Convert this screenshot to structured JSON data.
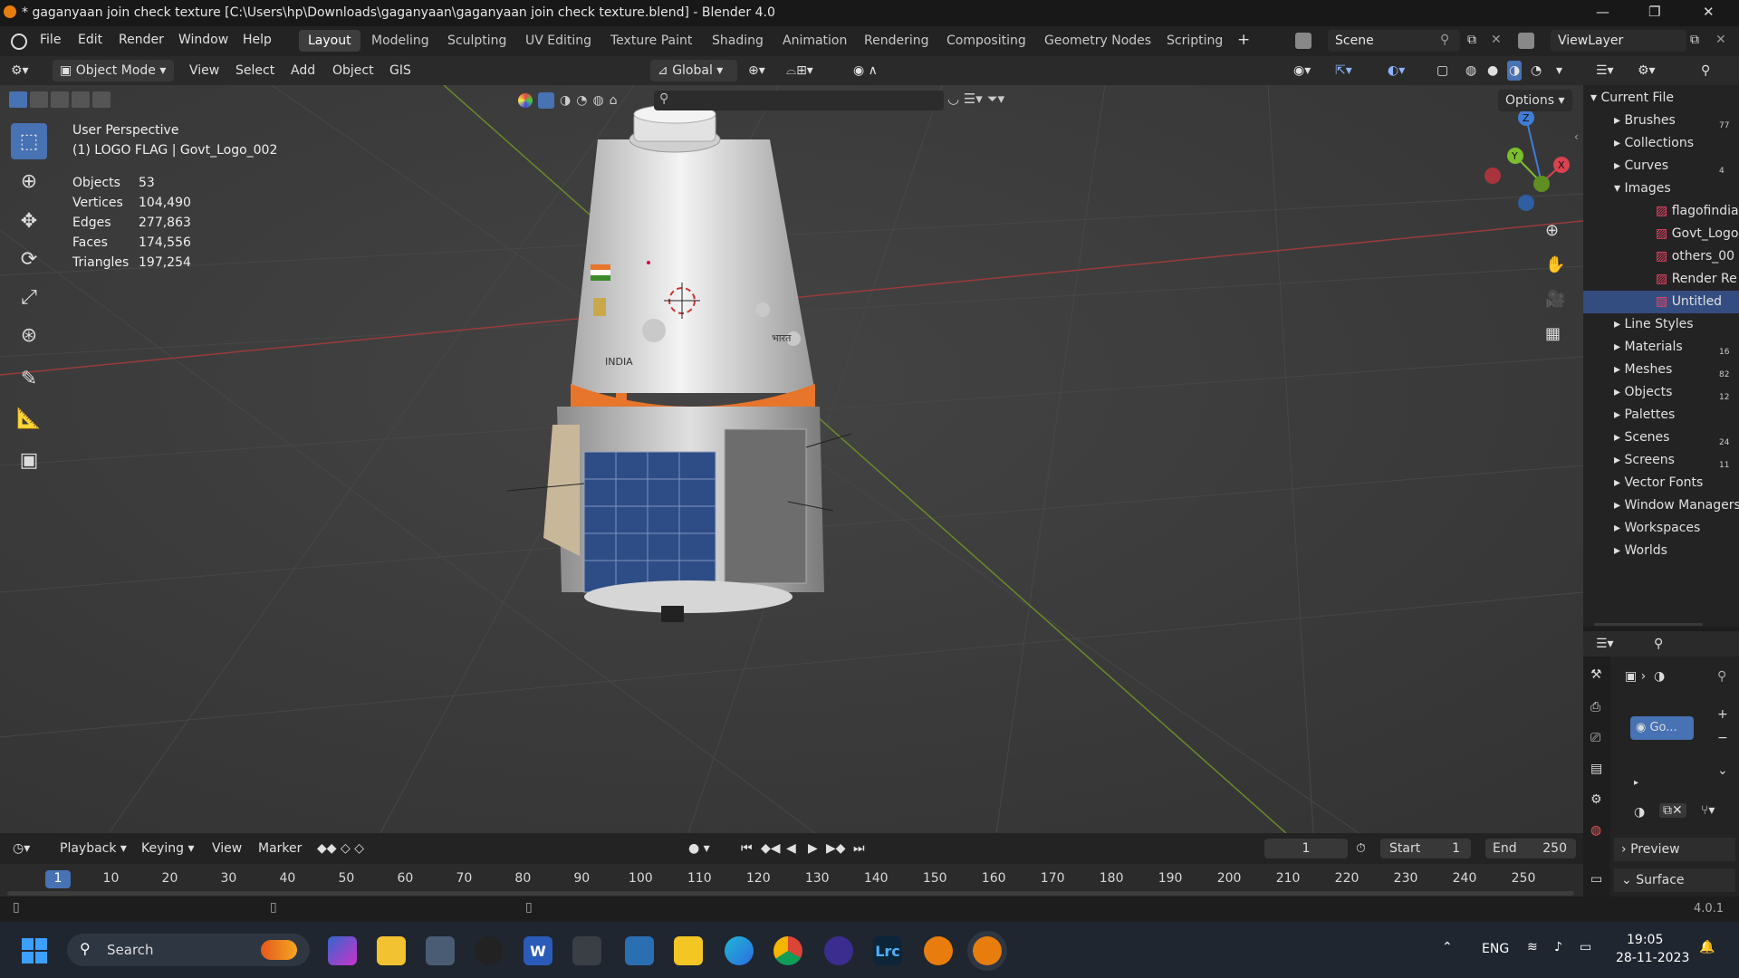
{
  "window": {
    "title": "* gaganyaan join check texture [C:\\Users\\hp\\Downloads\\gaganyaan\\gaganyaan join check texture.blend] - Blender 4.0",
    "controls": [
      "—",
      "❐",
      "✕"
    ]
  },
  "menu": [
    "File",
    "Edit",
    "Render",
    "Window",
    "Help"
  ],
  "workspaces": [
    "Layout",
    "Modeling",
    "Sculpting",
    "UV Editing",
    "Texture Paint",
    "Shading",
    "Animation",
    "Rendering",
    "Compositing",
    "Geometry Nodes",
    "Scripting"
  ],
  "active_workspace": "Layout",
  "scene_field": "Scene",
  "viewlayer_field": "ViewLayer",
  "viewport_header": {
    "mode": "Object Mode",
    "items": [
      "View",
      "Select",
      "Add",
      "Object",
      "GIS"
    ],
    "transform_orientation": "Global",
    "options": "Options"
  },
  "overlay": {
    "perspective": "User Perspective",
    "object": "(1) LOGO FLAG | Govt_Logo_002",
    "stats": [
      {
        "label": "Objects",
        "value": "53"
      },
      {
        "label": "Vertices",
        "value": "104,490"
      },
      {
        "label": "Edges",
        "value": "277,863"
      },
      {
        "label": "Faces",
        "value": "174,556"
      },
      {
        "label": "Triangles",
        "value": "197,254"
      }
    ]
  },
  "gizmo": {
    "x": "X",
    "y": "Y",
    "z": "Z"
  },
  "model_labels": {
    "india": "INDIA",
    "bharat": "भारत"
  },
  "outliner": {
    "root": "Current File",
    "items": [
      {
        "label": "Brushes",
        "count": "77",
        "expanded": false
      },
      {
        "label": "Collections",
        "count": "",
        "expanded": false
      },
      {
        "label": "Curves",
        "count": "4",
        "expanded": false
      },
      {
        "label": "Images",
        "count": "",
        "expanded": true
      }
    ],
    "images": [
      "flagofindia",
      "Govt_Logo",
      "others_00",
      "Render Re",
      "Untitled"
    ],
    "selected_image": "Untitled",
    "more_items": [
      {
        "label": "Line Styles",
        "count": ""
      },
      {
        "label": "Materials",
        "count": "16"
      },
      {
        "label": "Meshes",
        "count": "82"
      },
      {
        "label": "Objects",
        "count": "12"
      },
      {
        "label": "Palettes",
        "count": ""
      },
      {
        "label": "Scenes",
        "count": "24"
      },
      {
        "label": "Screens",
        "count": "11"
      },
      {
        "label": "Vector Fonts",
        "count": ""
      },
      {
        "label": "Window Managers",
        "count": ""
      },
      {
        "label": "Workspaces",
        "count": ""
      },
      {
        "label": "Worlds",
        "count": ""
      }
    ]
  },
  "properties": {
    "material_slot": "Go...",
    "preview": "Preview",
    "surface": "Surface"
  },
  "timeline": {
    "menus": [
      "Playback",
      "Keying",
      "View",
      "Marker"
    ],
    "current_frame": "1",
    "start_label": "Start",
    "start": "1",
    "end_label": "End",
    "end": "250",
    "ticks": [
      "1",
      "10",
      "20",
      "30",
      "40",
      "50",
      "60",
      "70",
      "80",
      "90",
      "100",
      "110",
      "120",
      "130",
      "140",
      "150",
      "160",
      "170",
      "180",
      "190",
      "200",
      "210",
      "220",
      "230",
      "240",
      "250"
    ]
  },
  "status": {
    "version": "4.0.1"
  },
  "taskbar": {
    "search": "Search",
    "lang": "ENG",
    "time": "19:05",
    "date": "28-11-2023",
    "lrc": "Lrc"
  },
  "colors": {
    "accent": "#4772b3",
    "x_axis": "#d9424f",
    "y_axis": "#7cbd2e",
    "z_axis": "#3f7dd6",
    "orange": "#e7752b"
  }
}
